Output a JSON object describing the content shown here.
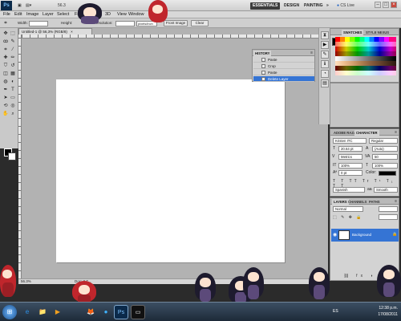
{
  "app": {
    "logo": "Ps",
    "zoom": "56.3",
    "workspaces": [
      "ESSENTIALS",
      "DESIGN",
      "PAINTING",
      "»"
    ],
    "cs_live": "CS Live",
    "window_controls": [
      "–",
      "□",
      "×"
    ]
  },
  "menu": [
    "File",
    "Edit",
    "Image",
    "Layer",
    "Select",
    "Filter",
    "3D",
    "View",
    "Window"
  ],
  "options_bar": {
    "width_label": "Width:",
    "height_label": "Height:",
    "resolution_label": "Resolution:",
    "units": "pixels/inch",
    "front_image_btn": "Front Image",
    "clear_btn": "Clear"
  },
  "document": {
    "tab_title": "Untitled-1 @ 56,3% (RGB/8)",
    "status_zoom": "56.3%",
    "status_doc": "Doc: 3.7..."
  },
  "panels": {
    "swatches_tabs": [
      "SWATCHES",
      "STYLE NEXUS"
    ],
    "history_title": "HISTORY",
    "history_items": [
      {
        "label": "Paste",
        "selected": false
      },
      {
        "label": "Crop",
        "selected": false
      },
      {
        "label": "Paste",
        "selected": false
      },
      {
        "label": "Delete Layer",
        "selected": true
      }
    ],
    "character_tabs": [
      "ADOBE RAZA",
      "CHARACTER"
    ],
    "font_family": "Kristen ITC",
    "font_style": "Regular",
    "font_size": "20.64 pt",
    "leading": "(Auto)",
    "kerning": "Metrics",
    "tracking": "50",
    "vscale": "100%",
    "hscale": "100%",
    "baseline": "0 pt",
    "color_label": "Color:",
    "language": "Spanish",
    "antialias": "Smooth",
    "layers_tabs": [
      "LAYERS",
      "CHANNELS",
      "PATHS"
    ],
    "blend_mode": "Normal",
    "layer_name": "Background"
  },
  "taskbar": {
    "lang": "ES",
    "time": "12:38 p.m.",
    "date": "17/08/2011",
    "apps": [
      "⊞",
      "e",
      "📁",
      "▶",
      "🦊",
      "●",
      "Ps",
      "▭"
    ]
  }
}
